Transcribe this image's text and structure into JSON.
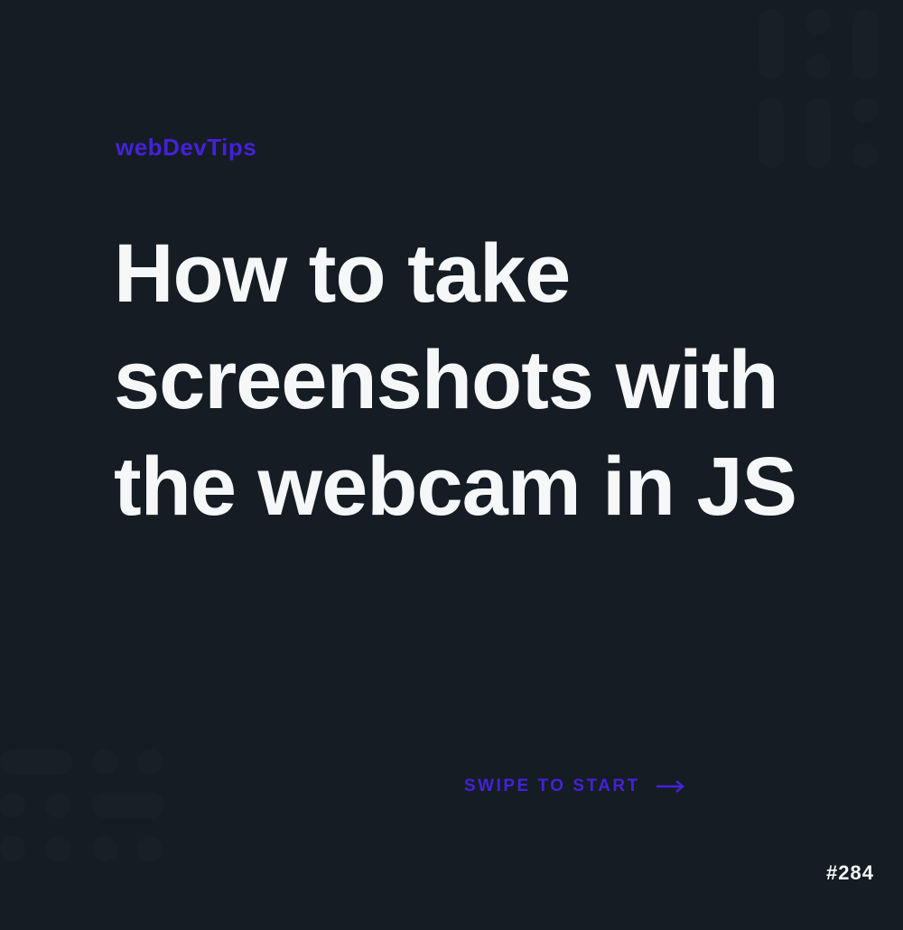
{
  "brand": "webDevTips",
  "title": "How to take screenshots with the webcam in JS",
  "swipe": "SWIPE TO START",
  "counter": "#284",
  "colors": {
    "background": "#151c23",
    "accent": "#4521d9",
    "text": "#f5f7f8"
  }
}
